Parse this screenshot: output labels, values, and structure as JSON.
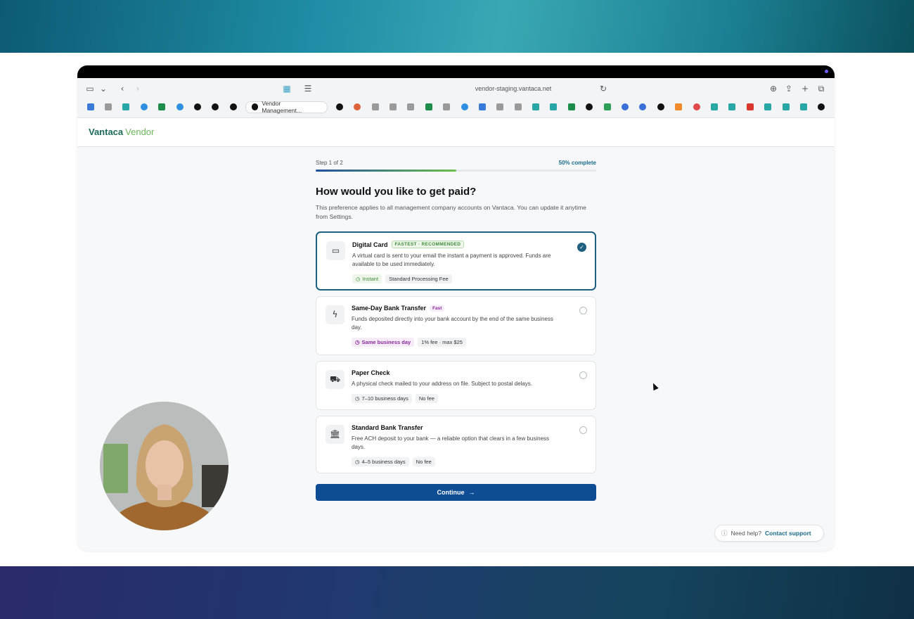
{
  "browser": {
    "url": "vendor-staging.vantaca.net",
    "active_tab": "Vendor Management..."
  },
  "app": {
    "brand": "Vantaca",
    "product": "Vendor"
  },
  "progress": {
    "step": "Step 1 of 2",
    "percent_label": "50% complete",
    "fraction": 0.5
  },
  "page": {
    "title": "How would you like to get paid?",
    "subtitle": "This preference applies to all management company accounts on Vantaca. You can update it anytime from Settings."
  },
  "options": [
    {
      "title": "Digital Card",
      "badge": "FASTEST · RECOMMENDED",
      "desc": "A virtual card is sent to your email the instant a payment is approved. Funds are available to be used immediately.",
      "timing": "Instant",
      "fee": "Standard Processing Fee",
      "selected": true
    },
    {
      "title": "Same-Day Bank Transfer",
      "badge": "Fast",
      "desc": "Funds deposited directly into your bank account by the end of the same business day.",
      "timing": "Same business day",
      "fee": "1% fee · max $25",
      "selected": false
    },
    {
      "title": "Paper Check",
      "desc": "A physical check mailed to your address on file. Subject to postal delays.",
      "timing": "7–10 business days",
      "fee": "No fee",
      "selected": false
    },
    {
      "title": "Standard Bank Transfer",
      "desc": "Free ACH deposit to your bank — a reliable option that clears in a few business days.",
      "timing": "4–5 business days",
      "fee": "No fee",
      "selected": false
    }
  ],
  "continue_label": "Continue",
  "help": {
    "text": "Need help?",
    "link": "Contact support"
  },
  "colors": {
    "primary": "#0e4c94",
    "accent": "#1f5f80",
    "progress_start": "#1f4fa0",
    "progress_end": "#6cc04a"
  }
}
